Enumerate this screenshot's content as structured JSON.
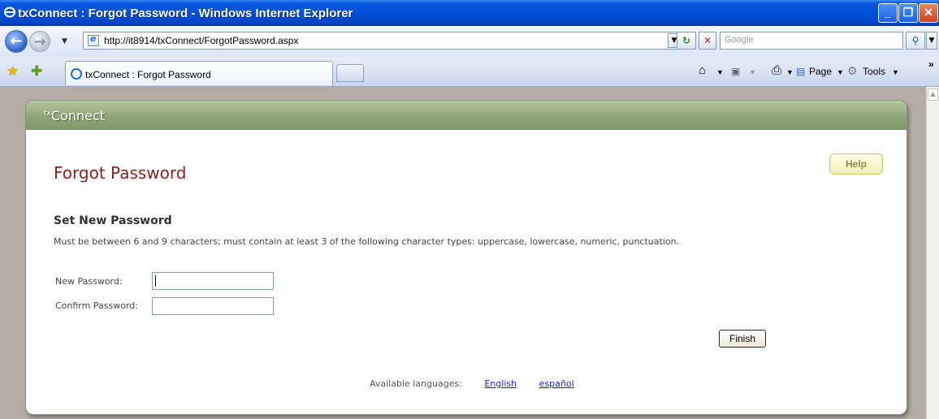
{
  "window": {
    "title": "txConnect : Forgot Password - Windows Internet Explorer",
    "minimize_label": "_",
    "restore_label": "❐",
    "close_label": "✕"
  },
  "addressbar": {
    "url": "http://it8914/txConnect/ForgotPassword.aspx",
    "search_placeholder": "Google",
    "refresh_label": "↻",
    "stop_label": "✕",
    "search_go_label": "⚲"
  },
  "tabs": {
    "active_label": "txConnect : Forgot Password"
  },
  "commandbar": {
    "page_label": "Page",
    "tools_label": "Tools",
    "overflow_label": "»"
  },
  "page": {
    "brand_sup": "tx",
    "brand": "Connect",
    "title": "Forgot Password",
    "help_label": "Help",
    "section_title": "Set New Password",
    "hint": "Must be between 6 and 9 characters; must contain at least 3 of the following character types: uppercase, lowercase, numeric, punctuation.",
    "new_password_label": "New Password:",
    "confirm_password_label": "Confirm Password:",
    "new_password_value": "",
    "confirm_password_value": "",
    "finish_label": "Finish",
    "languages_label": "Available languages:",
    "languages": [
      "English",
      "español"
    ]
  }
}
